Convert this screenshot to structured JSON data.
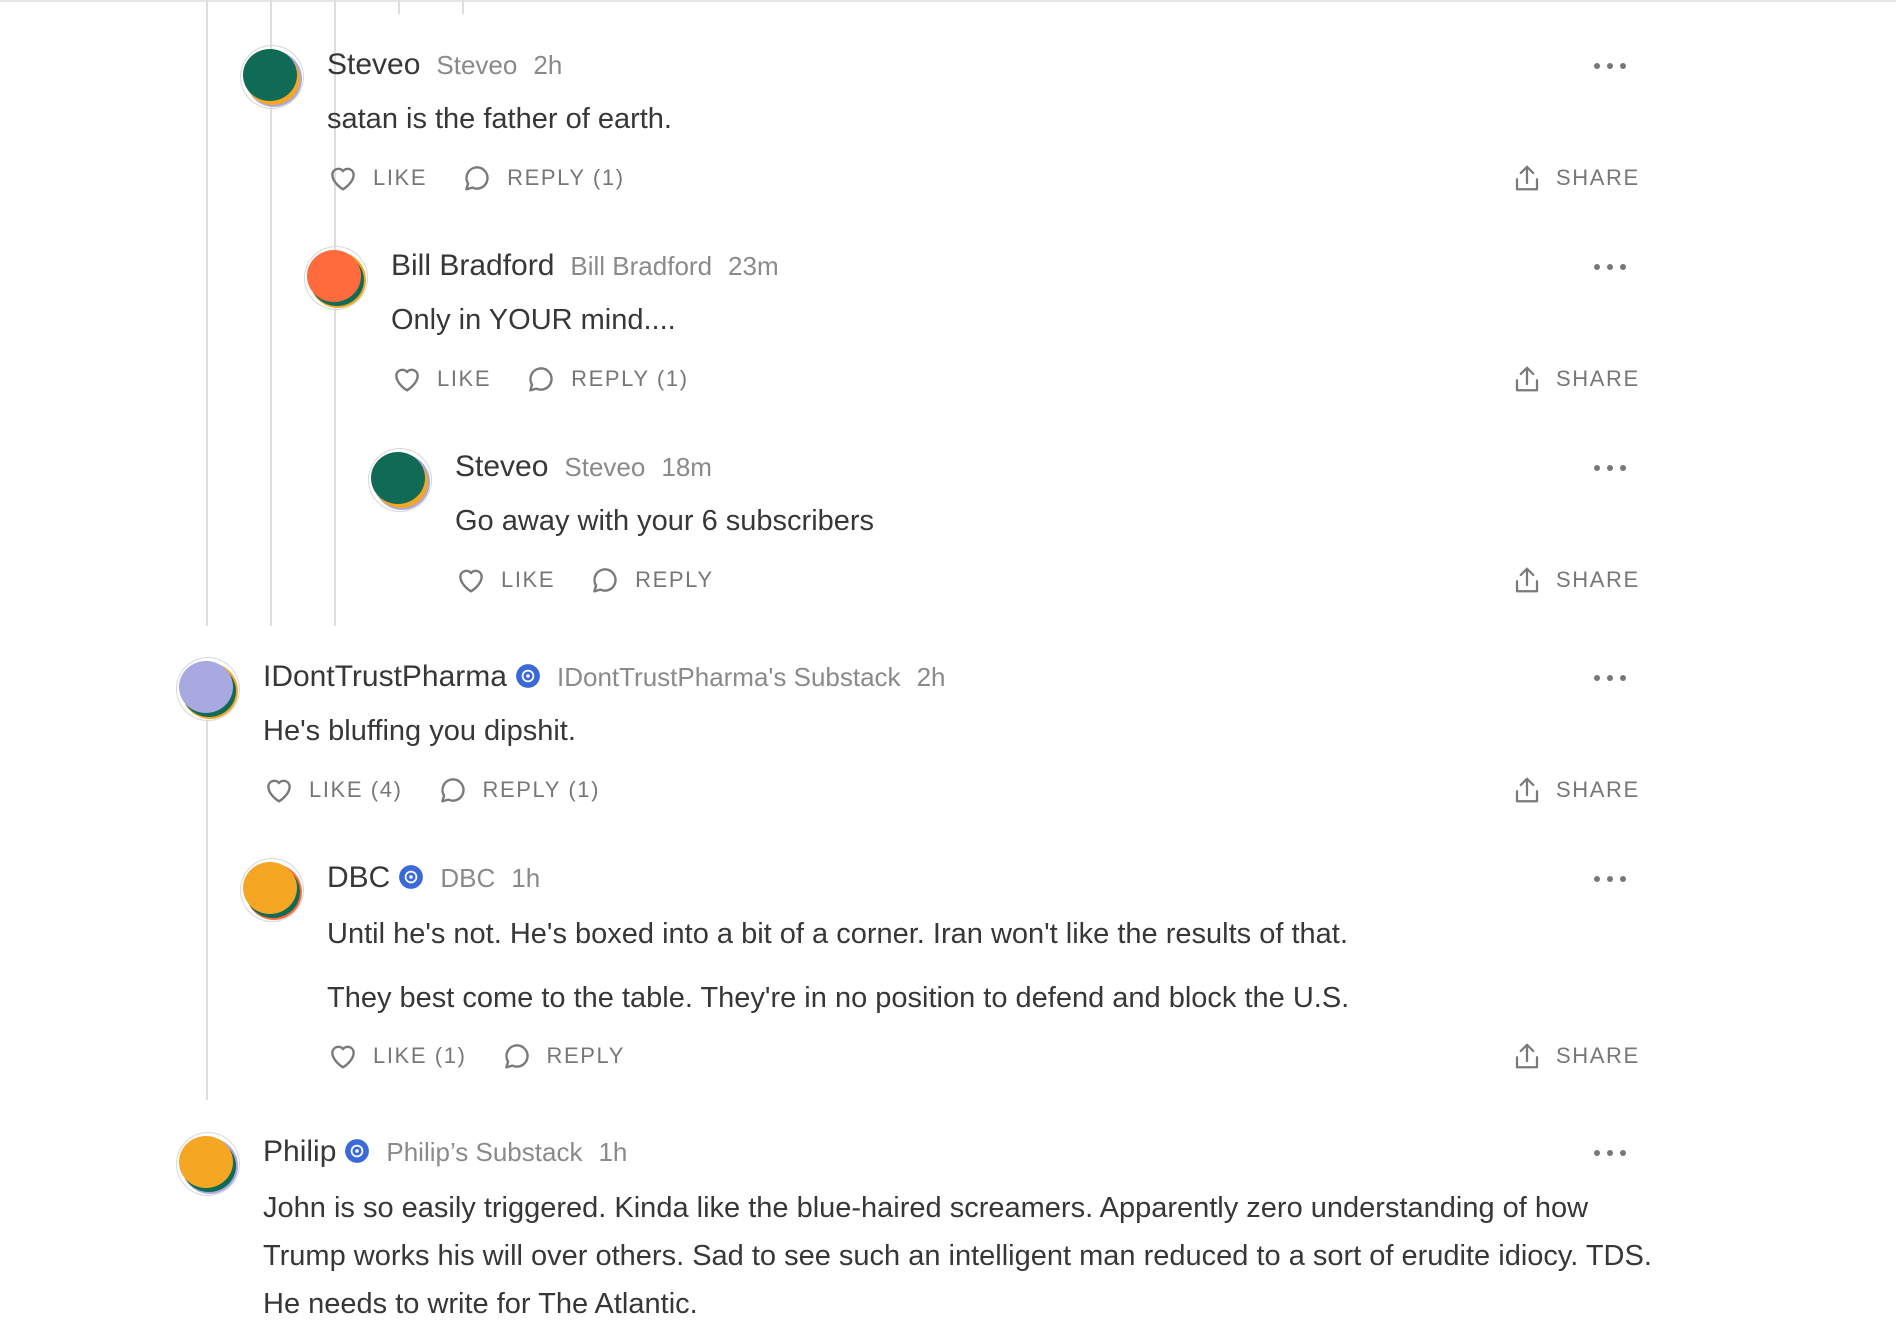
{
  "colors": {
    "badge": "#3b6ad8",
    "text": "#363737",
    "muted": "#8a8a8a",
    "action": "#777777"
  },
  "icons": {
    "like": "heart-icon",
    "reply": "comment-bubble-icon",
    "share": "share-upload-icon",
    "more": "more-dots-icon",
    "verified": "verified-badge-icon"
  },
  "comments": [
    {
      "name": "Steveo",
      "handle": "Steveo",
      "time": "2h",
      "body": [
        "satan is the father of earth."
      ],
      "like": "LIKE",
      "reply": "REPLY (1)",
      "share": "SHARE",
      "avatar": [
        "#0f6b55",
        "#f5a623",
        "#a7a9e0"
      ]
    },
    {
      "name": "Bill Bradford",
      "handle": "Bill Bradford",
      "time": "23m",
      "body": [
        "Only in YOUR mind...."
      ],
      "like": "LIKE",
      "reply": "REPLY (1)",
      "share": "SHARE",
      "avatar": [
        "#ff6b3d",
        "#0f6b55",
        "#f5a623"
      ]
    },
    {
      "name": "Steveo",
      "handle": "Steveo",
      "time": "18m",
      "body": [
        "Go away with your 6 subscribers"
      ],
      "like": "LIKE",
      "reply": "REPLY",
      "share": "SHARE",
      "avatar": [
        "#0f6b55",
        "#f5a623",
        "#a7a9e0"
      ]
    },
    {
      "name": "IDontTrustPharma",
      "handle": "IDontTrustPharma's Substack",
      "time": "2h",
      "body": [
        "He's bluffing you dipshit."
      ],
      "like": "LIKE (4)",
      "reply": "REPLY (1)",
      "share": "SHARE",
      "avatar": [
        "#a7a9e0",
        "#0f6b55",
        "#f5a623"
      ]
    },
    {
      "name": "DBC",
      "handle": "DBC",
      "time": "1h",
      "body": [
        "Until he's not. He's boxed into a bit of a corner. Iran won't like the results of that.",
        "They best come to the table. They're in no position to defend and block the U.S."
      ],
      "like": "LIKE (1)",
      "reply": "REPLY",
      "share": "SHARE",
      "avatar": [
        "#f5a623",
        "#0f6b55",
        "#ff6b3d"
      ]
    },
    {
      "name": "Philip",
      "handle": "Philip’s Substack",
      "time": "1h",
      "body": [
        "John is so easily triggered. Kinda like the blue-haired screamers. Apparently zero understanding of how Trump works his will over others. Sad to see such an intelligent man reduced to a sort of erudite idiocy. TDS. He needs to write for The Atlantic."
      ],
      "like": "",
      "reply": "",
      "share": "",
      "avatar": [
        "#f5a623",
        "#0f6b55",
        "#a7a9e0"
      ]
    }
  ]
}
